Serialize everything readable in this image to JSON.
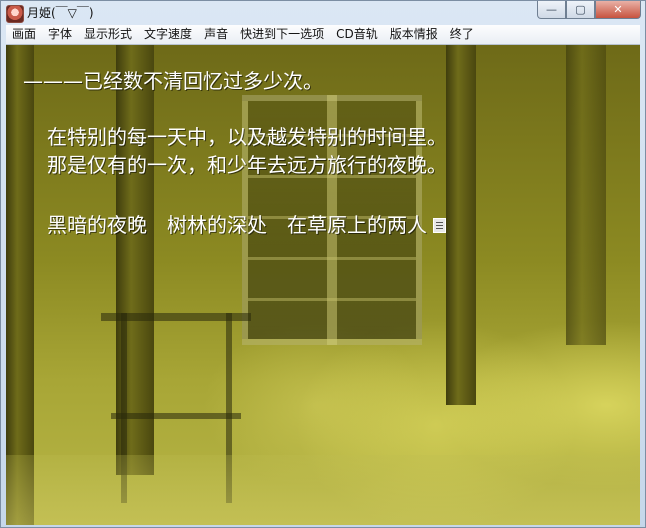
{
  "window": {
    "title": "月姫(￣▽￣)",
    "controls": {
      "minimize": "—",
      "maximize": "▢",
      "close": "✕"
    }
  },
  "menu": {
    "items": [
      "画面",
      "字体",
      "显示形式",
      "文字速度",
      "声音",
      "快进到下一选项",
      "CD音轨",
      "版本情报",
      "终了"
    ]
  },
  "story": {
    "lines": [
      "———已经数不清回忆过多少次。",
      "在特别的每一天中，以及越发特别的时间里。",
      "那是仅有的一次，和少年去远方旅行的夜晚。",
      "黑暗的夜晚　树林的深处　在草原上的两人"
    ],
    "continue_icon": "page-icon"
  }
}
